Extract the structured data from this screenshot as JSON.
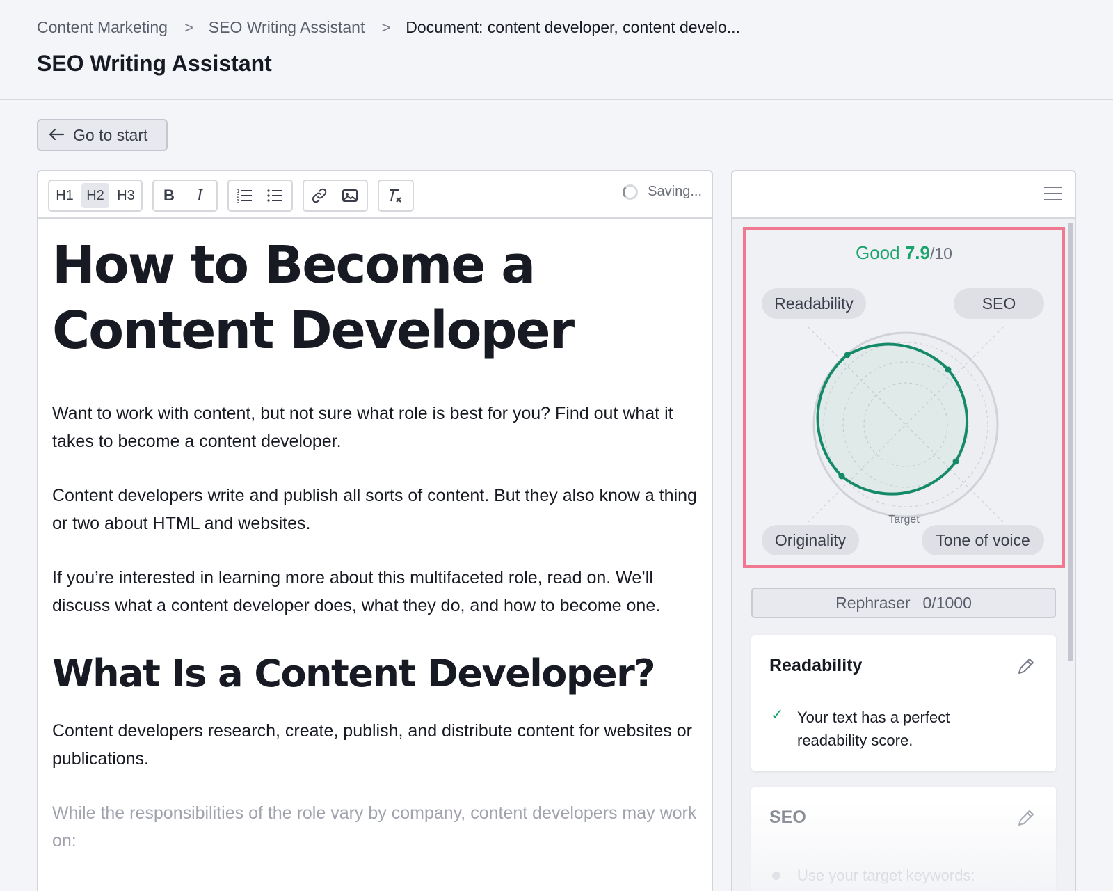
{
  "breadcrumb": {
    "item1": "Content Marketing",
    "item2": "SEO Writing Assistant",
    "current": "Document: content developer, content develo...",
    "separator": ">"
  },
  "page_title": "SEO Writing Assistant",
  "go_start_label": "Go to start",
  "toolbar": {
    "h1": "H1",
    "h2": "H2",
    "h3": "H3",
    "bold": "B",
    "italic": "I",
    "status": "Saving..."
  },
  "document": {
    "title": "How to Become a Content Developer",
    "p1": "Want to work with content, but not sure what role is best for you? Find out what it takes to become a content developer.",
    "p2": "Content developers write and publish all sorts of content. But they also know a thing or two about HTML and websites.",
    "p3": "If you’re interested in learning more about this multifaceted role, read on. We’ll discuss what a content developer does, what they do, and how to become one.",
    "h2": "What Is a Content Developer?",
    "p4": "Content developers research, create, publish, and distribute content for websites or publications.",
    "p5": "While the responsibilities of the role vary by company, content developers may work on:"
  },
  "score": {
    "label": "Good",
    "value": "7.9",
    "max": "/10",
    "color": "#1ba56c",
    "axes": {
      "readability": "Readability",
      "seo": "SEO",
      "originality": "Originality",
      "tone": "Tone of voice"
    },
    "target_label": "Target"
  },
  "rephraser": {
    "label": "Rephraser",
    "count": "0/1000"
  },
  "cards": {
    "readability": {
      "title": "Readability",
      "message": "Your text has a perfect readability score."
    },
    "seo": {
      "title": "SEO",
      "message": "Use your target keywords:"
    }
  },
  "colors": {
    "accent": "#1ba56c",
    "highlight_border": "#f07890"
  }
}
